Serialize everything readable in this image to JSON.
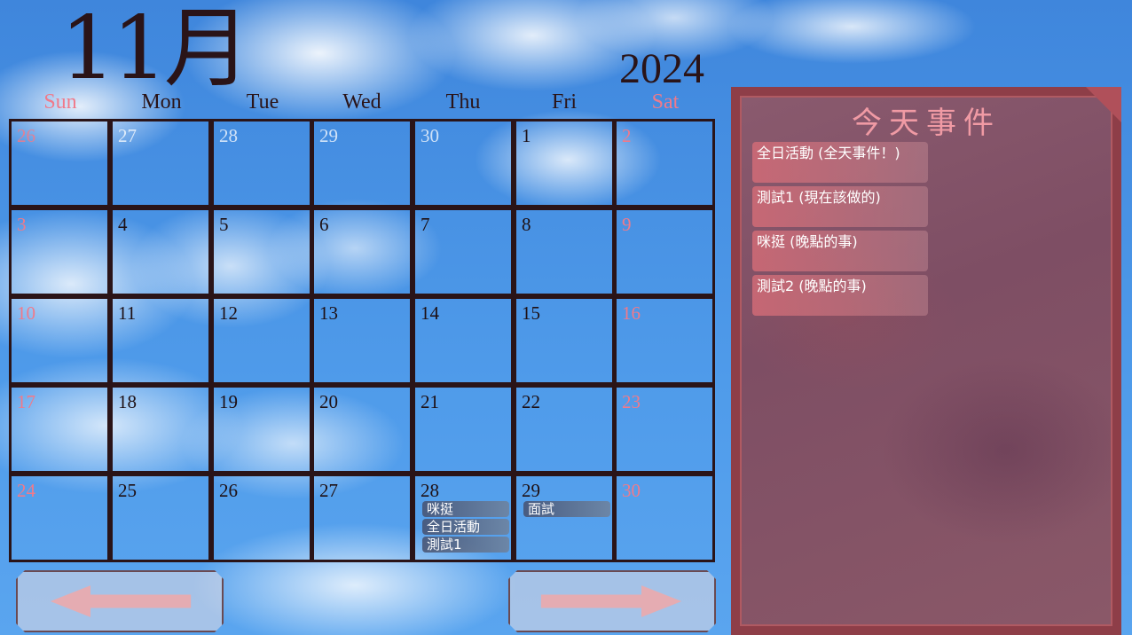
{
  "calendar": {
    "month": "11月",
    "year": "2024",
    "weekdays": [
      "Sun",
      "Mon",
      "Tue",
      "Wed",
      "Thu",
      "Fri",
      "Sat"
    ],
    "weeks": [
      [
        "26",
        "27",
        "28",
        "29",
        "30",
        "1",
        "2"
      ],
      [
        "3",
        "4",
        "5",
        "6",
        "7",
        "8",
        "9"
      ],
      [
        "10",
        "11",
        "12",
        "13",
        "14",
        "15",
        "16"
      ],
      [
        "17",
        "18",
        "19",
        "20",
        "21",
        "22",
        "23"
      ],
      [
        "24",
        "25",
        "26",
        "27",
        "28",
        "29",
        "30"
      ]
    ],
    "events": {
      "thu_28": [
        "咪挺",
        "全日活動",
        "測試1"
      ],
      "fri_29": [
        "面試"
      ]
    }
  },
  "today_panel": {
    "title": "今天事件",
    "items": [
      "全日活動 (全天事件！)",
      "測試1 (現在該做的)",
      "咪挺 (晚點的事)",
      "測試2 (晚點的事)"
    ]
  },
  "colors": {
    "weekend": "#f07a8a",
    "grid_line": "#2a1418",
    "panel_border": "#8e3e48",
    "panel_title": "#f09aa4"
  },
  "icons": {
    "prev": "arrow-left-icon",
    "next": "arrow-right-icon"
  }
}
